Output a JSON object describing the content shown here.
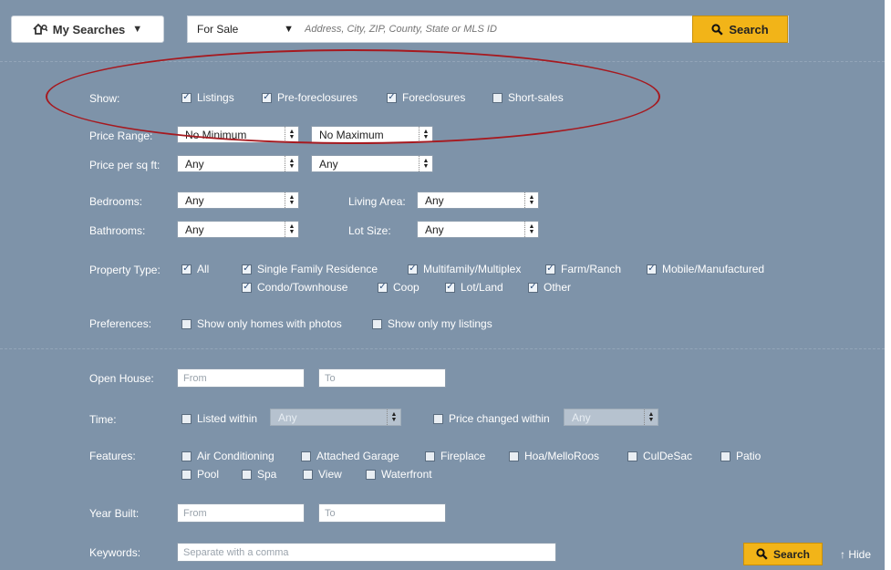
{
  "top": {
    "my_searches": "My Searches",
    "listing_type": "For Sale",
    "search_placeholder": "Address, City, ZIP, County, State or MLS ID",
    "search_button": "Search"
  },
  "show": {
    "label": "Show:",
    "options": [
      "Listings",
      "Pre-foreclosures",
      "Foreclosures",
      "Short-sales"
    ],
    "checked": [
      true,
      true,
      true,
      false
    ]
  },
  "price": {
    "label": "Price Range:",
    "min": "No Minimum",
    "max": "No Maximum"
  },
  "price_sqft": {
    "label": "Price per sq ft:",
    "min": "Any",
    "max": "Any"
  },
  "bedrooms": {
    "label": "Bedrooms:",
    "value": "Any"
  },
  "bathrooms": {
    "label": "Bathrooms:",
    "value": "Any"
  },
  "living_area": {
    "label": "Living Area:",
    "value": "Any"
  },
  "lot_size": {
    "label": "Lot Size:",
    "value": "Any"
  },
  "property_type": {
    "label": "Property Type:",
    "options": [
      "All",
      "Single Family Residence",
      "Multifamily/Multiplex",
      "Farm/Ranch",
      "Mobile/Manufactured",
      "Condo/Townhouse",
      "Coop",
      "Lot/Land",
      "Other"
    ],
    "checked": [
      true,
      true,
      true,
      true,
      true,
      true,
      true,
      true,
      true
    ]
  },
  "preferences": {
    "label": "Preferences:",
    "options": [
      "Show only homes with photos",
      "Show only my listings"
    ]
  },
  "open_house": {
    "label": "Open House:",
    "from": "From",
    "to": "To"
  },
  "time": {
    "label": "Time:",
    "listed_within": "Listed within",
    "listed_value": "Any",
    "price_changed": "Price changed within",
    "price_changed_value": "Any"
  },
  "features": {
    "label": "Features:",
    "options": [
      "Air Conditioning",
      "Attached Garage",
      "Fireplace",
      "Hoa/MelloRoos",
      "CulDeSac",
      "Patio",
      "Pool",
      "Spa",
      "View",
      "Waterfront"
    ]
  },
  "year_built": {
    "label": "Year Built:",
    "from": "From",
    "to": "To"
  },
  "keywords": {
    "label": "Keywords:",
    "placeholder": "Separate with a comma"
  },
  "bottom": {
    "search_button": "Search",
    "hide": "Hide"
  },
  "colors": {
    "panel": "#7e93a9",
    "accent": "#f2b418",
    "annotation": "#a6191f"
  }
}
